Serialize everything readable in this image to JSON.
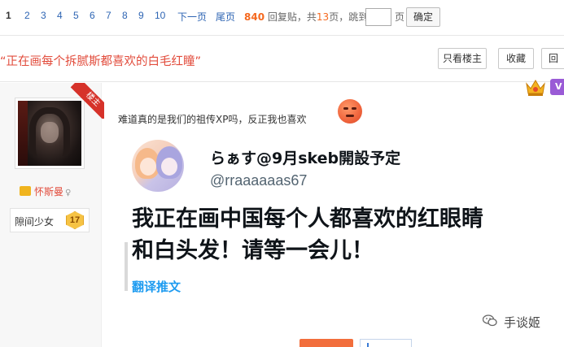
{
  "pager": {
    "pages": [
      "1",
      "2",
      "3",
      "4",
      "5",
      "6",
      "7",
      "8",
      "9",
      "10"
    ],
    "current": "1",
    "next_label": "下一页",
    "last_label": "尾页",
    "reply_count": "840",
    "reply_text": "回复贴，共",
    "total_pages": "13",
    "pages_suffix": "页，跳到",
    "jump_value": "",
    "page_unit": "页",
    "confirm_label": "确定"
  },
  "thread": {
    "title": "“正在画每个拆腻斯都喜欢的白毛红瞳”",
    "only_op_label": "只看楼主",
    "favorite_label": "收藏",
    "reply_label": "回"
  },
  "user": {
    "op_badge": "楼主",
    "name": "怀斯曼",
    "gender_mark": "♀",
    "rank_name": "隙间少女",
    "rank_level": "17",
    "vip_label": "V"
  },
  "post": {
    "text": "难道真的是我们的祖传XP吗，反正我也喜欢",
    "tweet": {
      "name": "らぁす@9月skeb開設予定",
      "handle": "@rraaaaaas67",
      "body_line1": "我正在画中国每个人都喜欢的红眼睛",
      "body_line2": "和白头发！请等一会儿！",
      "translate_label": "翻译推文"
    }
  },
  "watermark": {
    "text": "手谈姬"
  },
  "colors": {
    "link": "#2d64b3",
    "title_red": "#e24c3c",
    "reply_orange": "#f5691f",
    "twitter_blue": "#1d9bf0"
  }
}
